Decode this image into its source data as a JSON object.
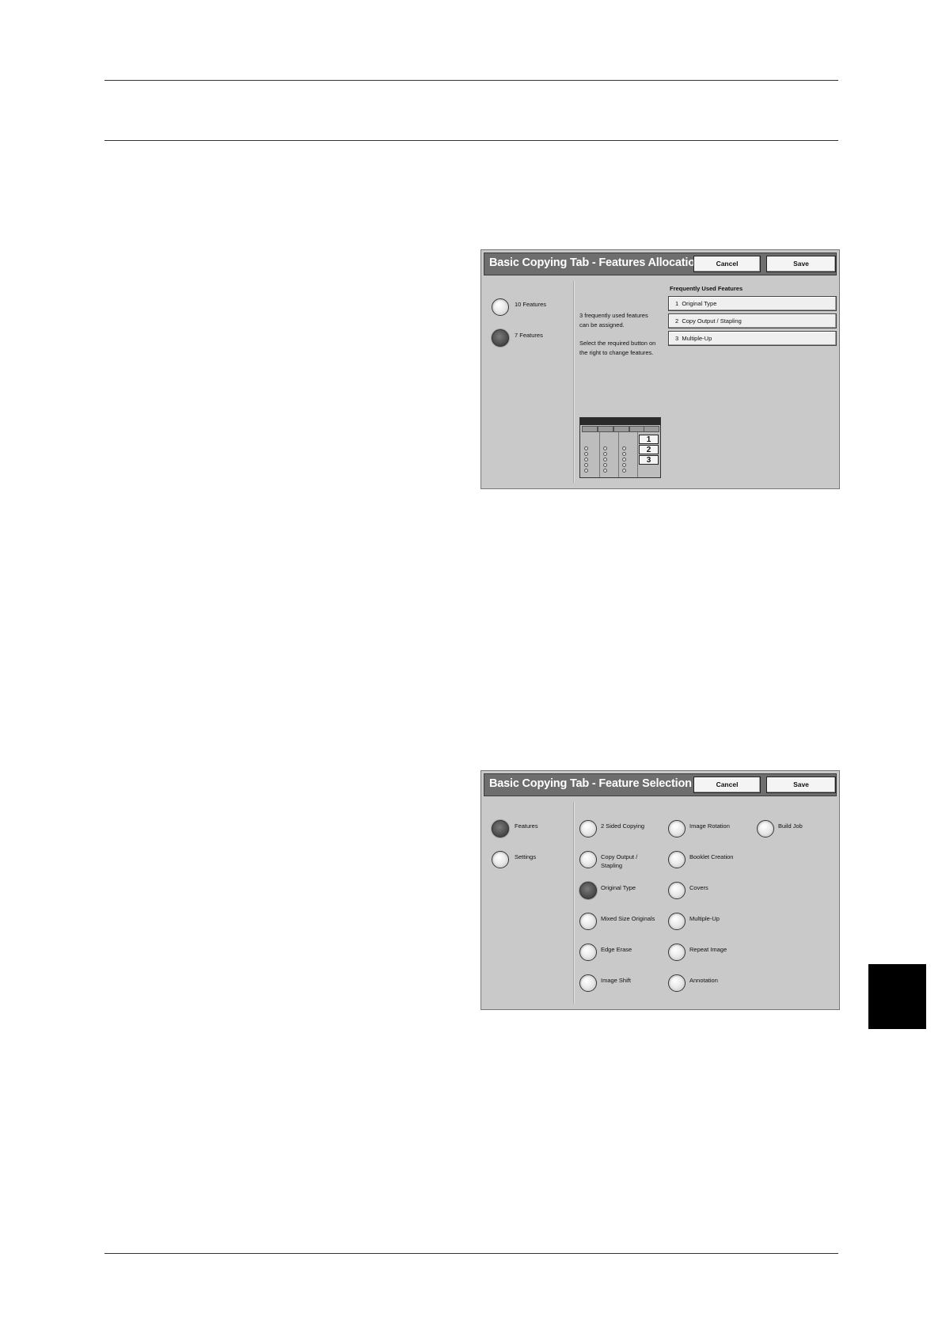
{
  "screen1": {
    "title": "Basic Copying Tab - Features Allocation",
    "cancel_label": "Cancel",
    "save_label": "Save",
    "options": [
      {
        "label": "10 Features",
        "selected": false
      },
      {
        "label": "7 Features",
        "selected": true
      }
    ],
    "info_text_1": "3 frequently used features can be assigned.",
    "info_text_2": "Select the required button on the right to change features.",
    "frequently_used_heading": "Frequently Used Features",
    "features": [
      {
        "num": "1",
        "label": "Original Type"
      },
      {
        "num": "2",
        "label": "Copy Output / Stapling"
      },
      {
        "num": "3",
        "label": "Multiple-Up"
      }
    ],
    "preview_numbers": [
      "1",
      "2",
      "3"
    ]
  },
  "screen2": {
    "title": "Basic Copying Tab - Feature Selection",
    "cancel_label": "Cancel",
    "save_label": "Save",
    "options": [
      {
        "label": "Features",
        "selected": true
      },
      {
        "label": "Settings",
        "selected": false
      }
    ],
    "columns": [
      [
        {
          "label": "2 Sided Copying",
          "selected": false
        },
        {
          "label": "Copy Output / Stapling",
          "selected": false
        },
        {
          "label": "Original Type",
          "selected": true
        },
        {
          "label": "Mixed Size Originals",
          "selected": false
        },
        {
          "label": "Edge Erase",
          "selected": false
        },
        {
          "label": "Image Shift",
          "selected": false
        }
      ],
      [
        {
          "label": "Image Rotation",
          "selected": false
        },
        {
          "label": "Booklet Creation",
          "selected": false
        },
        {
          "label": "Covers",
          "selected": false
        },
        {
          "label": "Multiple-Up",
          "selected": false
        },
        {
          "label": "Repeat Image",
          "selected": false
        },
        {
          "label": "Annotation",
          "selected": false
        }
      ],
      [
        {
          "label": "Build Job",
          "selected": false
        }
      ]
    ]
  }
}
